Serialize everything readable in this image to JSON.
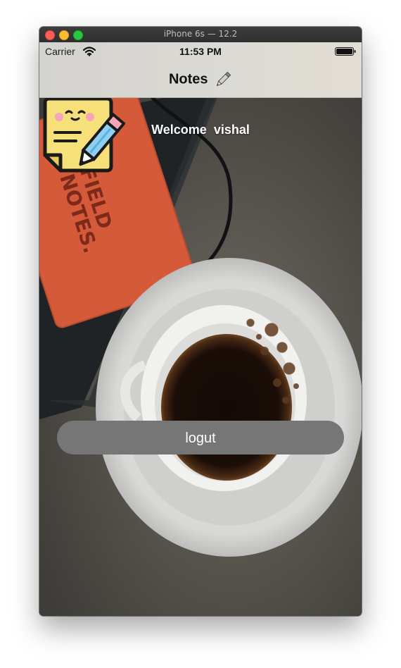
{
  "window": {
    "title": "iPhone 6s — 12.2"
  },
  "status_bar": {
    "carrier": "Carrier",
    "time": "11:53 PM",
    "icons": [
      "wifi-icon",
      "battery-icon"
    ]
  },
  "nav": {
    "title": "Notes",
    "title_icon": "pencil-icon"
  },
  "main": {
    "welcome_label": "Welcome",
    "user_name": "vishal",
    "welcome_text": "Welcome  vishal",
    "logo_icon": "sticky-note-pencil-icon",
    "logout_label": "logut",
    "background_image": "field-notes-notebook-and-coffee-cup-photo"
  },
  "colors": {
    "button_bg": "#767676",
    "button_text": "#ffffff",
    "navbar_bg": "#d8d6d1",
    "notebook": "#d85a3c",
    "note_yellow": "#f6e17a"
  }
}
